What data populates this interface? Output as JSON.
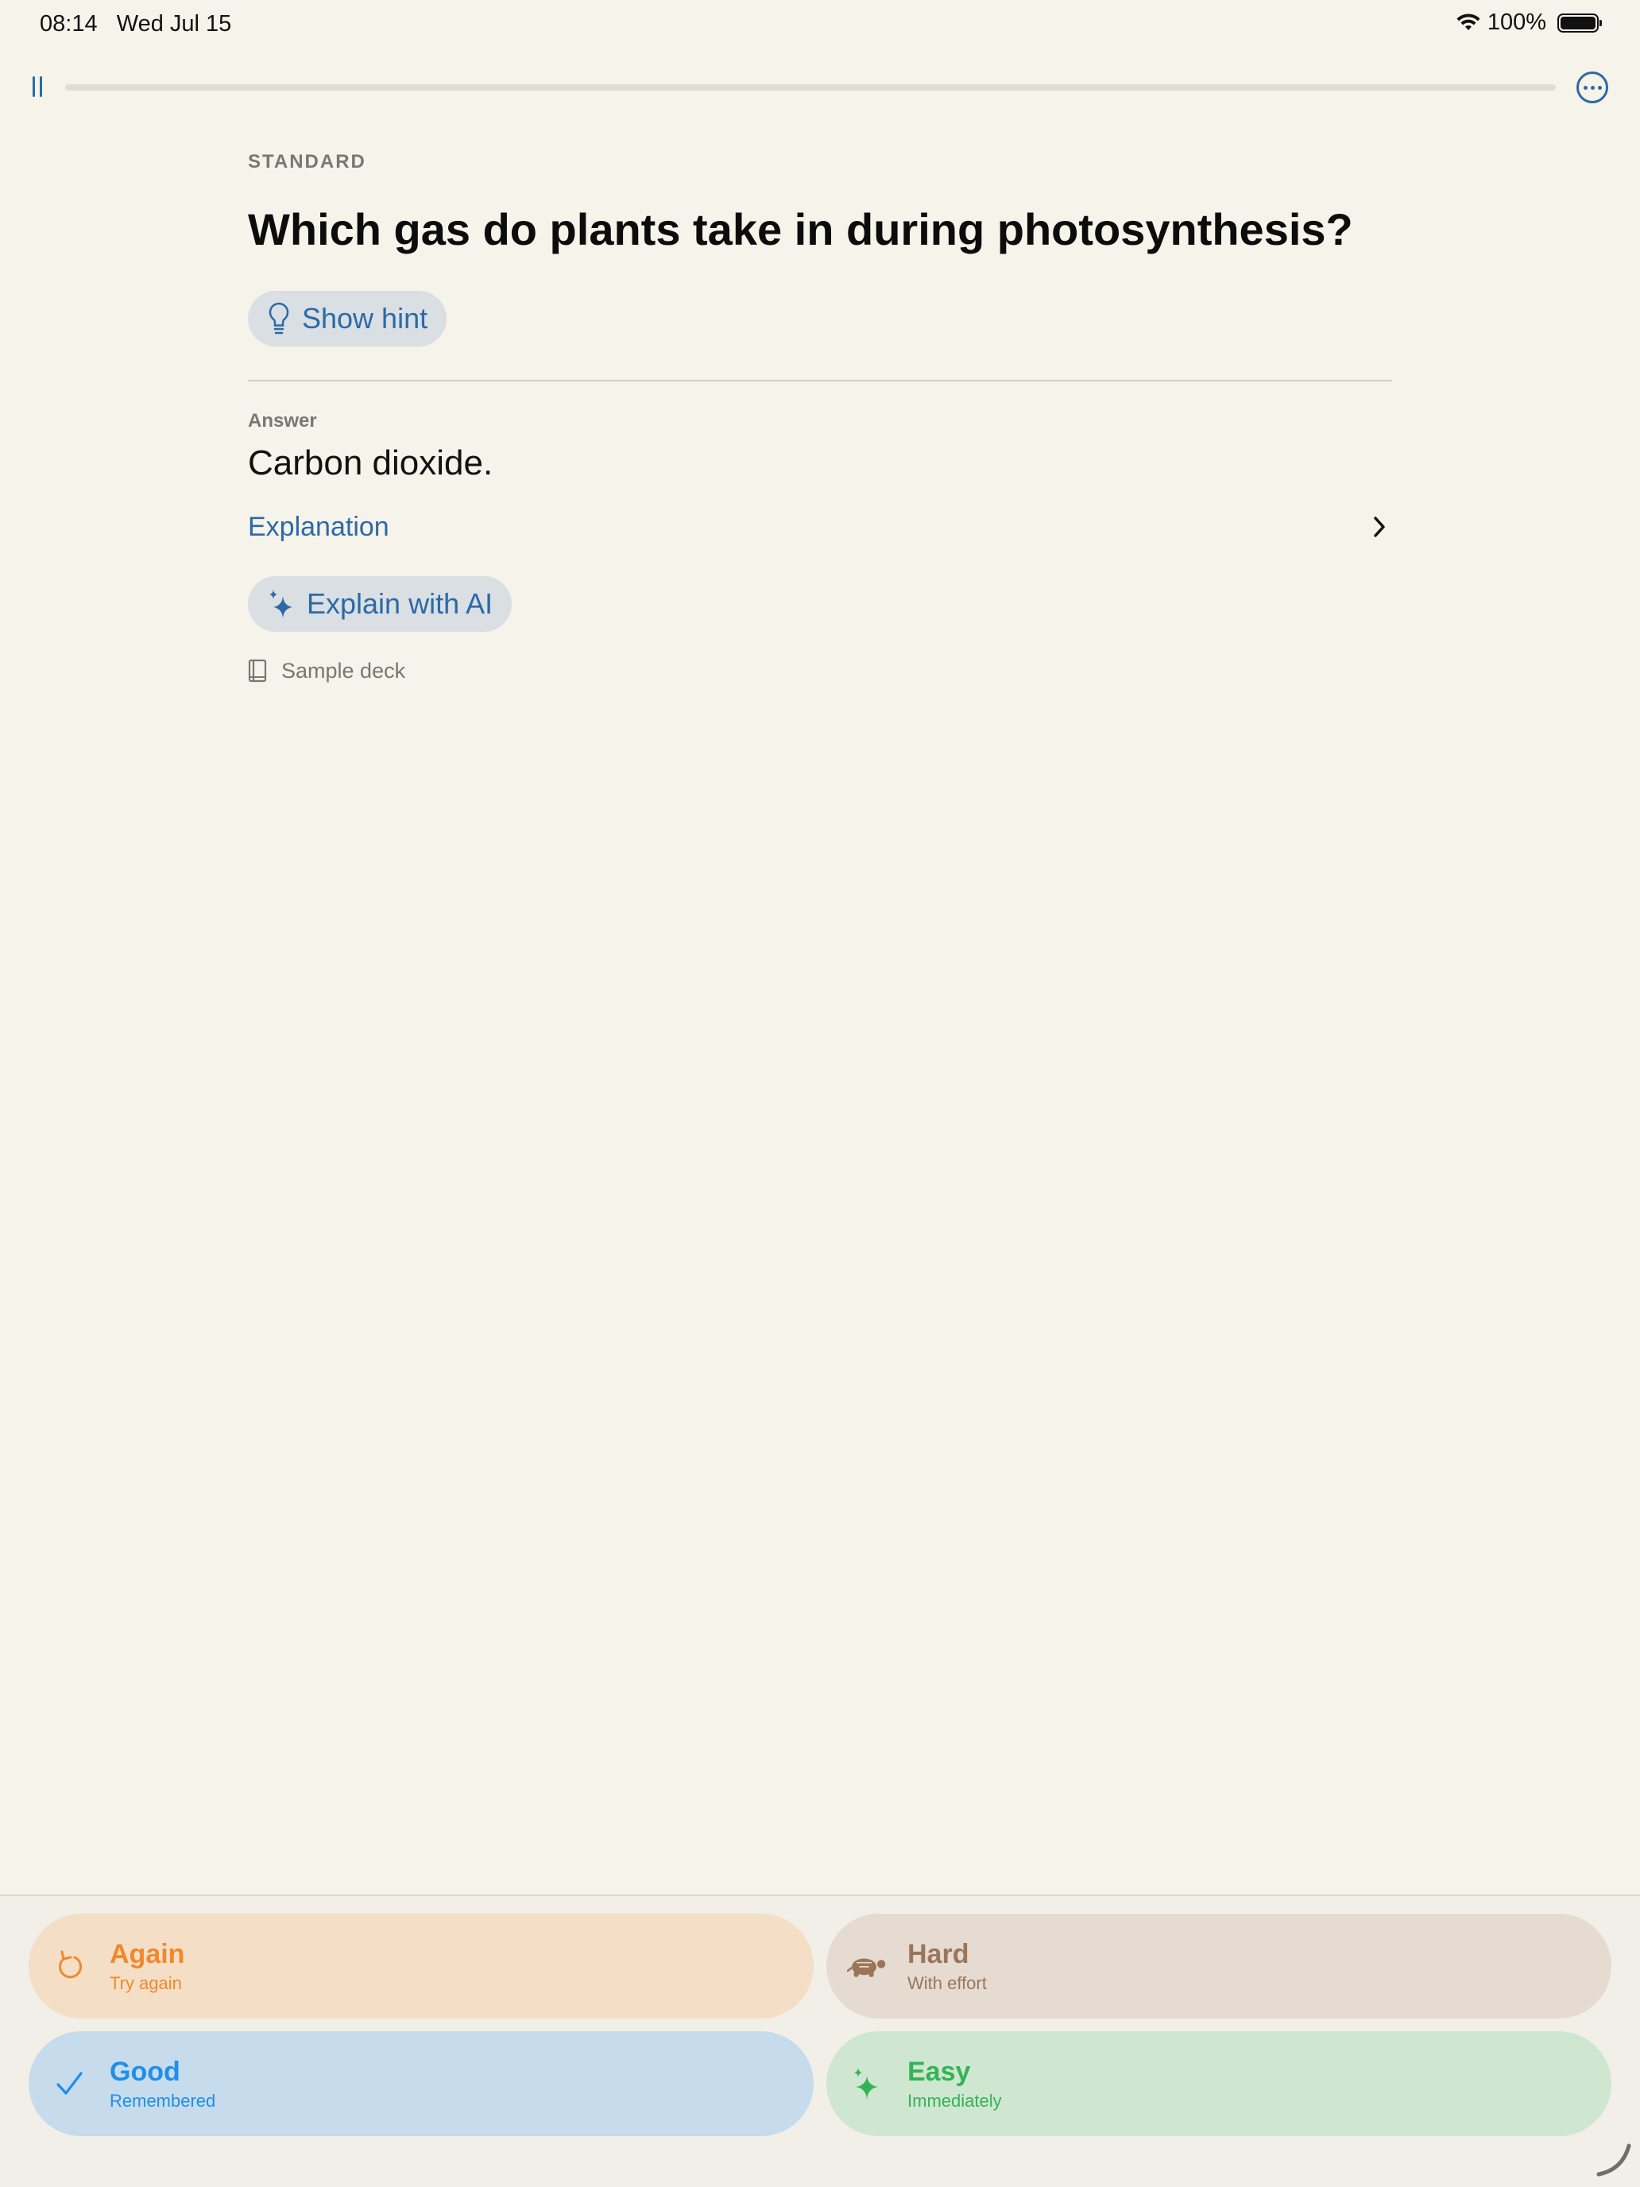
{
  "status_bar": {
    "time": "08:14",
    "date": "Wed Jul 15",
    "battery": "100%"
  },
  "toolbar": {
    "pause_icon": "pause-icon",
    "more_icon": "ellipsis-circle-icon",
    "progress": 0.0
  },
  "card": {
    "type_label": "STANDARD",
    "question": "Which gas do plants take in during photosynthesis?",
    "hint_label": "Show hint",
    "answer_label": "Answer",
    "answer_text": "Carbon dioxide.",
    "explanation_label": "Explanation",
    "ai_label": "Explain with AI",
    "deck_name": "Sample deck"
  },
  "ratings": [
    {
      "title": "Again",
      "subtitle": "Try again",
      "icon": "retry-arrow-icon",
      "color": "#f0892c"
    },
    {
      "title": "Hard",
      "subtitle": "With effort",
      "icon": "turtle-icon",
      "color": "#9c7558"
    },
    {
      "title": "Good",
      "subtitle": "Remembered",
      "icon": "checkmark-icon",
      "color": "#1f8fe8"
    },
    {
      "title": "Easy",
      "subtitle": "Immediately",
      "icon": "sparkle-icon",
      "color": "#34b356"
    }
  ],
  "colors": {
    "accent": "#2c6aa6",
    "background": "#f6f3ea"
  }
}
